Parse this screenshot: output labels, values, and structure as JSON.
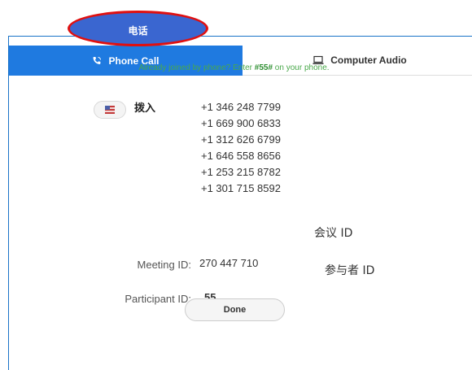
{
  "callout": {
    "label": "电话"
  },
  "tabs": [
    {
      "label": "Phone Call",
      "icon": "phone-icon",
      "active": true
    },
    {
      "label": "Computer Audio",
      "icon": "monitor-icon",
      "active": false
    }
  ],
  "hint": {
    "before": "Already joined by phone? Enter ",
    "code": "#55#",
    "after": " on your phone."
  },
  "dial_in": {
    "label": "拨入",
    "numbers": [
      "+1 346 248 7799",
      "+1 669 900 6833",
      "+1 312 626 6799",
      "+1 646 558 8656",
      "+1 253 215 8782",
      "+1 301 715 8592"
    ]
  },
  "annotations": {
    "meeting_id": "会议 ID",
    "participant_id": "参与者 ID"
  },
  "meeting": {
    "label": "Meeting ID:",
    "value": "270 447 710"
  },
  "participant": {
    "label": "Participant ID:",
    "value": "55"
  },
  "done_label": "Done",
  "colors": {
    "accent": "#1f7ae0",
    "hint_green": "#49a84a",
    "callout_border": "#e01010",
    "callout_fill": "#3a66d0"
  }
}
